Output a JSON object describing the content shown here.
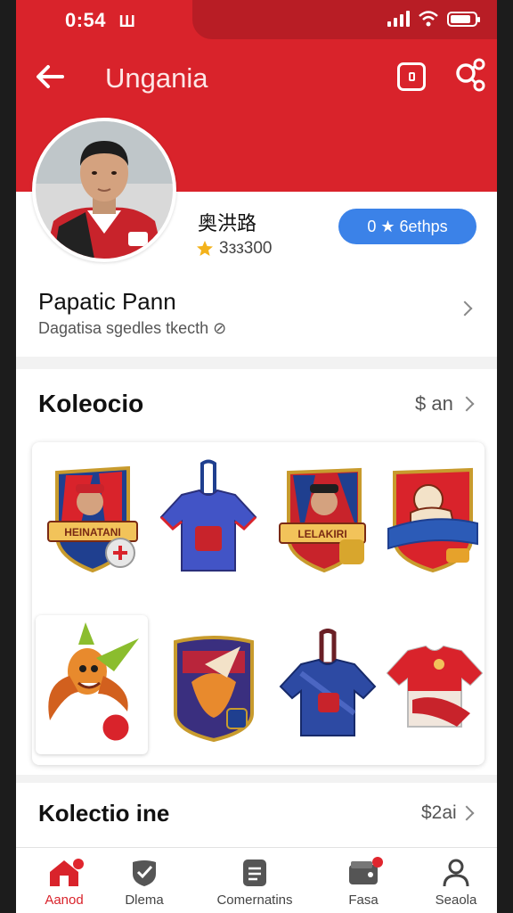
{
  "status": {
    "time": "0:54",
    "carrier_glyph": "Ш"
  },
  "header": {
    "title": "Ungania"
  },
  "profile": {
    "handle": "奥洪路",
    "points": "3зз300",
    "badge_label": "0 ★ 6ethps",
    "name": "Papatic Pann",
    "subtitle": "Dagatisa sgedles tkecth ⊘"
  },
  "collection": {
    "title": "Koleocio",
    "link": "$ an",
    "items": [
      {
        "icon": "player-shield-badge",
        "label": "HEINATANI"
      },
      {
        "icon": "jersey-keychain-blue"
      },
      {
        "icon": "player-shield-badge-red",
        "label": "LELAKIRI"
      },
      {
        "icon": "knight-shield-badge"
      },
      {
        "icon": "bird-mascot-sticker"
      },
      {
        "icon": "mascot-shield-badge"
      },
      {
        "icon": "jersey-keychain-navy"
      },
      {
        "icon": "jersey-red-white"
      }
    ]
  },
  "collection2": {
    "title": "Kolectio ine",
    "link": "$2ai"
  },
  "nav": {
    "items": [
      {
        "label": "Aanod",
        "icon": "home-icon",
        "active": true
      },
      {
        "label": "Dlema",
        "icon": "shield-icon",
        "active": false
      },
      {
        "label": "Comernatins",
        "icon": "list-icon",
        "active": false
      },
      {
        "label": "Fasa",
        "icon": "wallet-icon",
        "active": false
      },
      {
        "label": "Seaola",
        "icon": "profile-icon",
        "active": false
      }
    ]
  },
  "colors": {
    "brand_red": "#d9232b",
    "badge_blue": "#3b82e8",
    "star_gold": "#f3b21b"
  }
}
